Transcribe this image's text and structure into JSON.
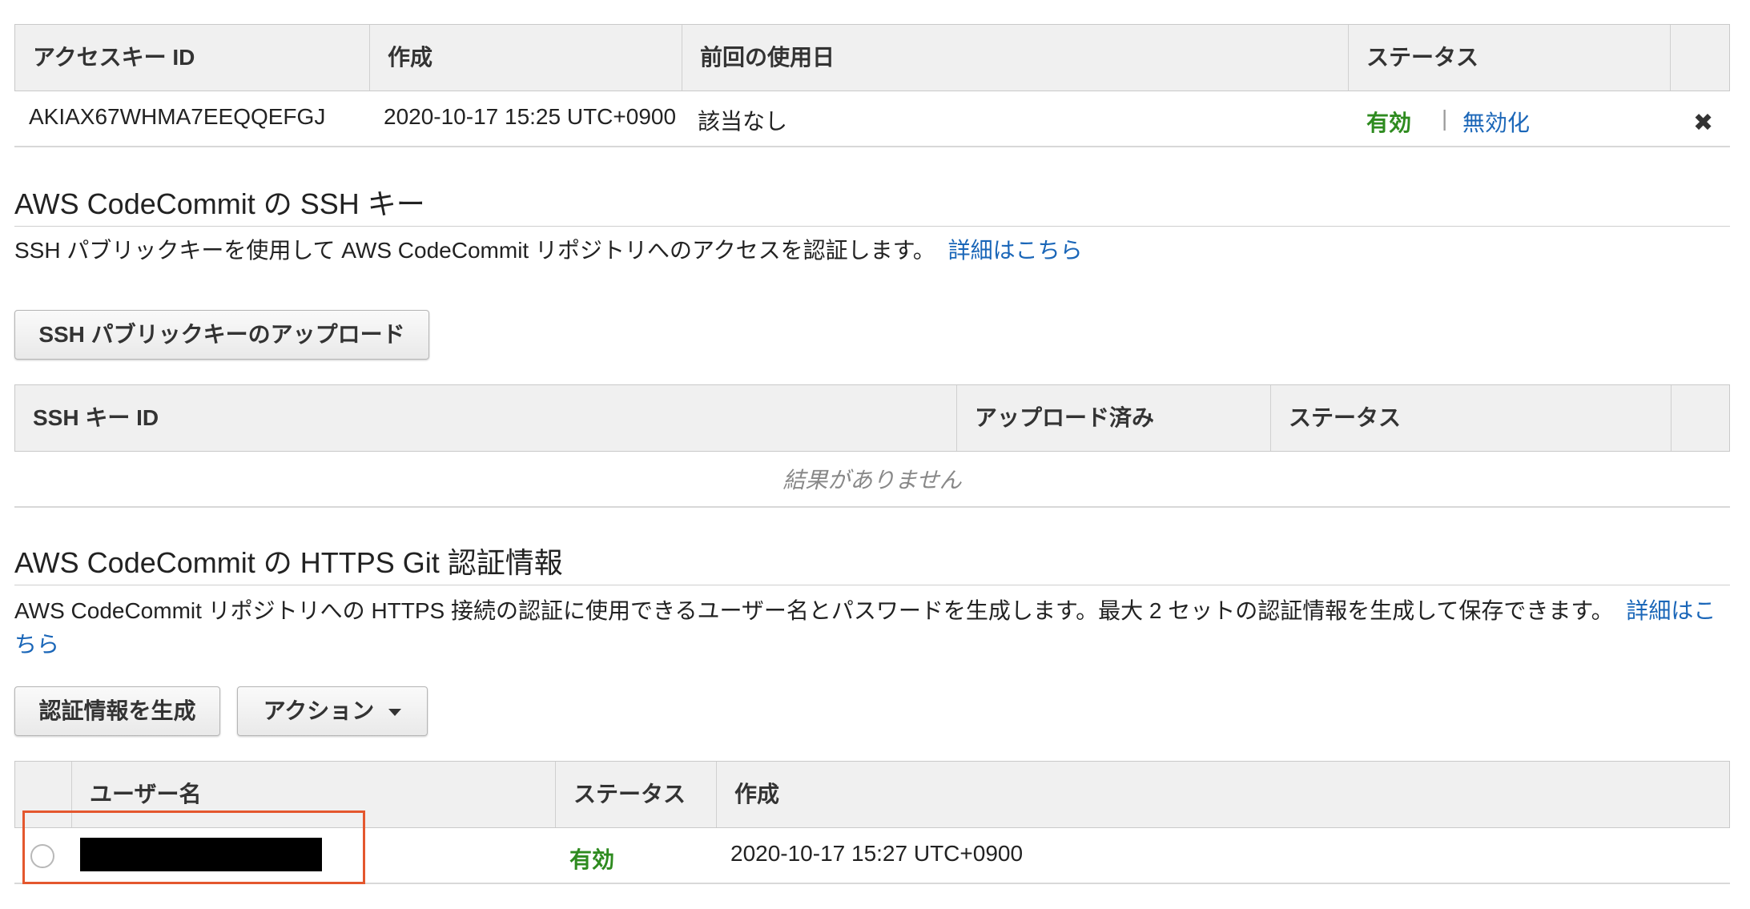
{
  "access_keys": {
    "headers": [
      "アクセスキー ID",
      "作成",
      "前回の使用日",
      "ステータス"
    ],
    "row": {
      "key_id": "AKIAX67WHMA7EEQQEFGJ",
      "created": "2020-10-17 15:25 UTC+0900",
      "last_used": "該当なし",
      "status": "有効",
      "separator": "|",
      "deactivate": "無効化",
      "delete_icon": "close-icon"
    }
  },
  "ssh": {
    "title": "AWS CodeCommit の SSH キー",
    "description": "SSH パブリックキーを使用して AWS CodeCommit リポジトリへのアクセスを認証します。",
    "learn_more": "詳細はこちら",
    "upload_button": "SSH パブリックキーのアップロード",
    "headers": [
      "SSH キー ID",
      "アップロード済み",
      "ステータス"
    ],
    "empty": "結果がありません"
  },
  "https": {
    "title": "AWS CodeCommit の HTTPS Git 認証情報",
    "description": "AWS CodeCommit リポジトリへの HTTPS 接続の認証に使用できるユーザー名とパスワードを生成します。最大 2 セットの認証情報を生成して保存できます。",
    "learn_more": "詳細はこちら",
    "generate_button": "認証情報を生成",
    "actions_button": "アクション",
    "headers": [
      "ユーザー名",
      "ステータス",
      "作成"
    ],
    "row": {
      "status": "有効",
      "created": "2020-10-17 15:27 UTC+0900"
    }
  },
  "colors": {
    "active_green": "#2e8b1f",
    "link_blue": "#1a66b8",
    "highlight_red": "#e4572e"
  }
}
